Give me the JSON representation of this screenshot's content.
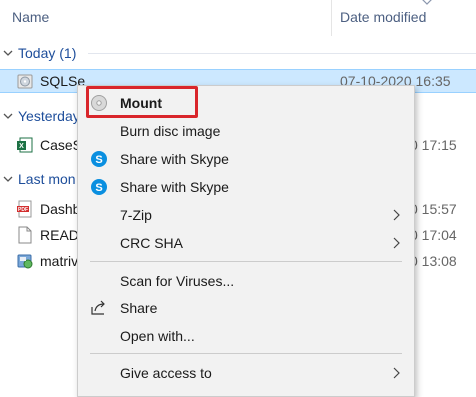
{
  "columns": {
    "name": "Name",
    "date_modified": "Date modified"
  },
  "groups": [
    {
      "label": "Today (1)"
    },
    {
      "label": "Yesterday"
    },
    {
      "label": "Last mon"
    }
  ],
  "files": [
    {
      "name": "SQLSe",
      "date": "07-10-2020 16:35",
      "icon": "disc-image-icon"
    },
    {
      "name": "CaseS",
      "date": "0 17:15",
      "icon": "excel-file-icon"
    },
    {
      "name": "Dashb",
      "date": "0 15:57",
      "icon": "pdf-file-icon"
    },
    {
      "name": "READ",
      "date": "0 17:04",
      "icon": "text-file-icon"
    },
    {
      "name": "matriv",
      "date": "0 13:08",
      "icon": "installer-icon"
    }
  ],
  "context_menu": {
    "items": [
      {
        "label": "Mount",
        "icon": "disc-icon",
        "bold": true
      },
      {
        "label": "Burn disc image"
      },
      {
        "label": "Share with Skype",
        "icon": "skype-icon"
      },
      {
        "label": "Share with Skype",
        "icon": "skype-icon"
      },
      {
        "label": "7-Zip",
        "submenu": true
      },
      {
        "label": "CRC SHA",
        "submenu": true
      },
      {
        "label": "Scan for Viruses..."
      },
      {
        "label": "Share",
        "icon": "share-icon"
      },
      {
        "label": "Open with..."
      },
      {
        "label": "Give access to",
        "submenu": true
      }
    ]
  },
  "colors": {
    "highlight_border": "#d9262b",
    "selection_bg": "#cce8ff",
    "group_text": "#1e4e9b",
    "skype_blue": "#0a8fe0"
  }
}
